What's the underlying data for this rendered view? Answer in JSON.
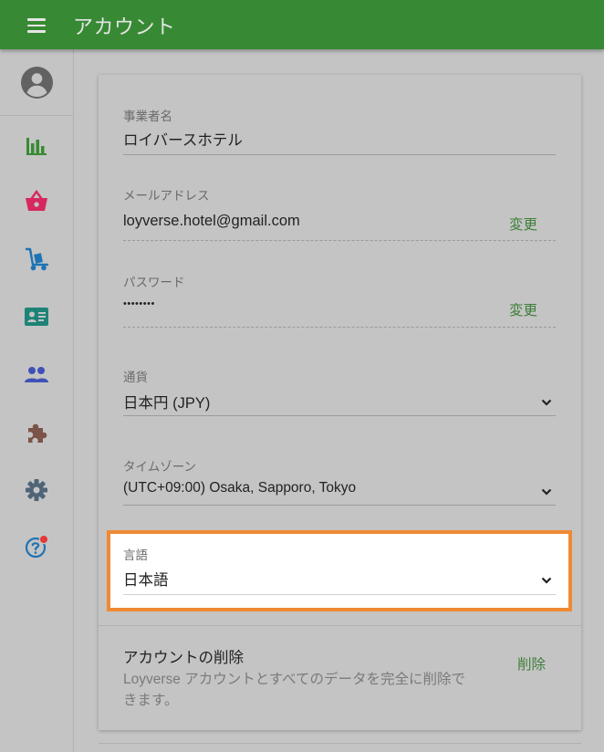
{
  "app": {
    "title": "アカウント"
  },
  "fields": {
    "business_name": {
      "label": "事業者名",
      "value": "ロイバースホテル"
    },
    "email": {
      "label": "メールアドレス",
      "value": "loyverse.hotel@gmail.com",
      "action": "変更"
    },
    "password": {
      "label": "パスワード",
      "value": "••••••••",
      "action": "変更"
    },
    "currency": {
      "label": "通貨",
      "value": "日本円 (JPY)"
    },
    "timezone": {
      "label": "タイムゾーン",
      "value": "(UTC+09:00) Osaka, Sapporo, Tokyo"
    },
    "language": {
      "label": "言語",
      "value": "日本語"
    }
  },
  "delete_account": {
    "title": "アカウントの削除",
    "description": "Loyverse アカウントとすべてのデータを完全に削除できます。",
    "action": "削除"
  },
  "sidebar": {
    "icons": [
      "avatar-icon",
      "bar-chart-icon",
      "basket-icon",
      "hand-truck-icon",
      "id-card-icon",
      "people-icon",
      "puzzle-icon",
      "gear-icon",
      "help-icon"
    ]
  },
  "colors": {
    "header": "#378a33",
    "accent_link": "#3f7f3a",
    "highlight_border": "#ef8a32",
    "notification_dot": "#e53935"
  }
}
